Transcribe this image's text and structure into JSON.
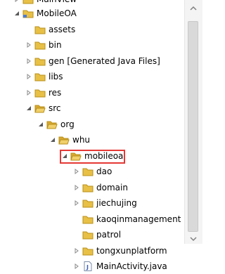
{
  "tree": {
    "partial_top_label": "MainView",
    "items": [
      {
        "label": "MobileOA",
        "icon": "project-icon",
        "twisty": "expanded"
      },
      {
        "label": "assets",
        "icon": "folder-icon",
        "twisty": "none"
      },
      {
        "label": "bin",
        "icon": "folder-icon",
        "twisty": "collapsed"
      },
      {
        "label": "gen [Generated Java Files]",
        "icon": "folder-icon",
        "twisty": "collapsed"
      },
      {
        "label": "libs",
        "icon": "folder-icon",
        "twisty": "collapsed"
      },
      {
        "label": "res",
        "icon": "folder-icon",
        "twisty": "collapsed"
      },
      {
        "label": "src",
        "icon": "folder-open-icon",
        "twisty": "expanded"
      },
      {
        "label": "org",
        "icon": "folder-open-icon",
        "twisty": "expanded"
      },
      {
        "label": "whu",
        "icon": "folder-open-icon",
        "twisty": "expanded"
      },
      {
        "label": "mobileoa",
        "icon": "folder-open-icon",
        "twisty": "expanded",
        "highlight": true
      },
      {
        "label": "dao",
        "icon": "folder-icon",
        "twisty": "collapsed"
      },
      {
        "label": "domain",
        "icon": "folder-icon",
        "twisty": "collapsed"
      },
      {
        "label": "jiechujing",
        "icon": "folder-icon",
        "twisty": "collapsed"
      },
      {
        "label": "kaoqinmanagement",
        "icon": "folder-icon",
        "twisty": "none"
      },
      {
        "label": "patrol",
        "icon": "folder-icon",
        "twisty": "none"
      },
      {
        "label": "tongxunplatform",
        "icon": "folder-icon",
        "twisty": "collapsed"
      },
      {
        "label": "MainActivity.java",
        "icon": "java-file-icon",
        "twisty": "collapsed"
      }
    ]
  },
  "colors": {
    "highlight": "#e53935",
    "folder": "#e8c046",
    "twisty": "#6b6b6b"
  }
}
